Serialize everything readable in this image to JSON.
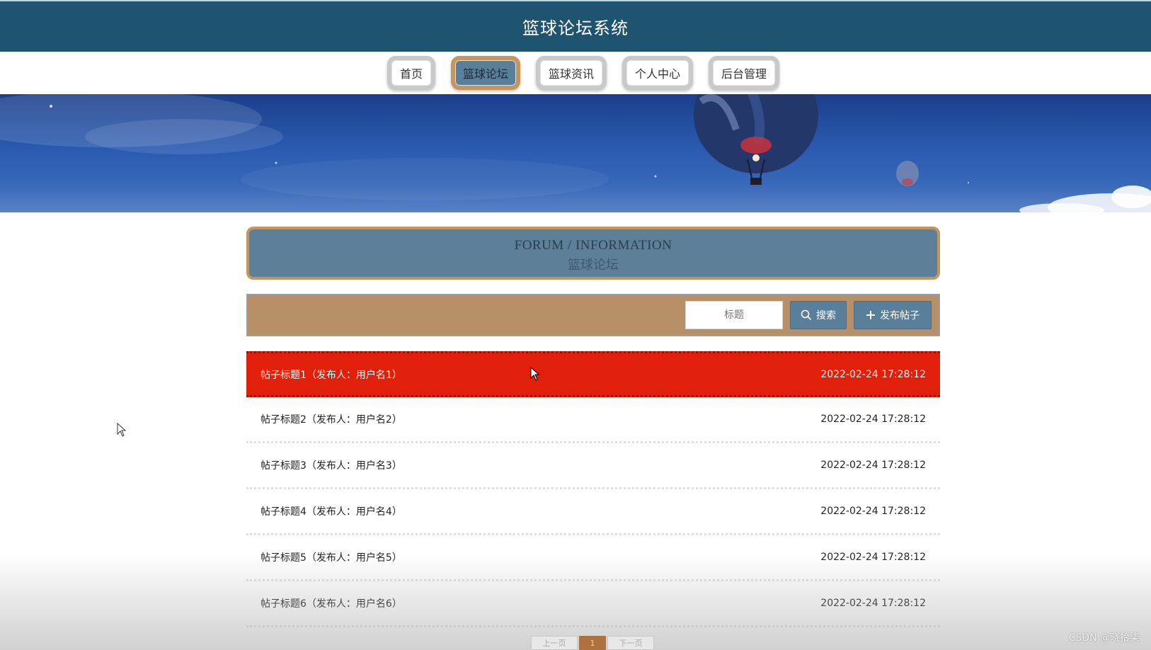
{
  "header": {
    "title": "篮球论坛系统"
  },
  "nav": {
    "items": [
      {
        "label": "首页"
      },
      {
        "label": "篮球论坛"
      },
      {
        "label": "篮球资讯"
      },
      {
        "label": "个人中心"
      },
      {
        "label": "后台管理"
      }
    ],
    "active_index": 1
  },
  "section": {
    "title_en": "FORUM / INFORMATION",
    "title_cn": "篮球论坛"
  },
  "toolbar": {
    "search_placeholder": "标题",
    "search_label": "搜索",
    "publish_label": "发布帖子"
  },
  "posts": [
    {
      "title": "帖子标题1（发布人：用户名1）",
      "time": "2022-02-24 17:28:12"
    },
    {
      "title": "帖子标题2（发布人：用户名2）",
      "time": "2022-02-24 17:28:12"
    },
    {
      "title": "帖子标题3（发布人：用户名3）",
      "time": "2022-02-24 17:28:12"
    },
    {
      "title": "帖子标题4（发布人：用户名4）",
      "time": "2022-02-24 17:28:12"
    },
    {
      "title": "帖子标题5（发布人：用户名5）",
      "time": "2022-02-24 17:28:12"
    },
    {
      "title": "帖子标题6（发布人：用户名6）",
      "time": "2022-02-24 17:28:12"
    }
  ],
  "pagination": {
    "prev": "上一页",
    "current": "1",
    "next": "下一页"
  },
  "watermark": "CSDN @晓拾柒",
  "colors": {
    "header_bg": "#1f5470",
    "accent": "#5a7f9a",
    "toolbar_bg": "#b89068",
    "highlight_row": "#e0200a",
    "border_gold": "#c6955e"
  }
}
